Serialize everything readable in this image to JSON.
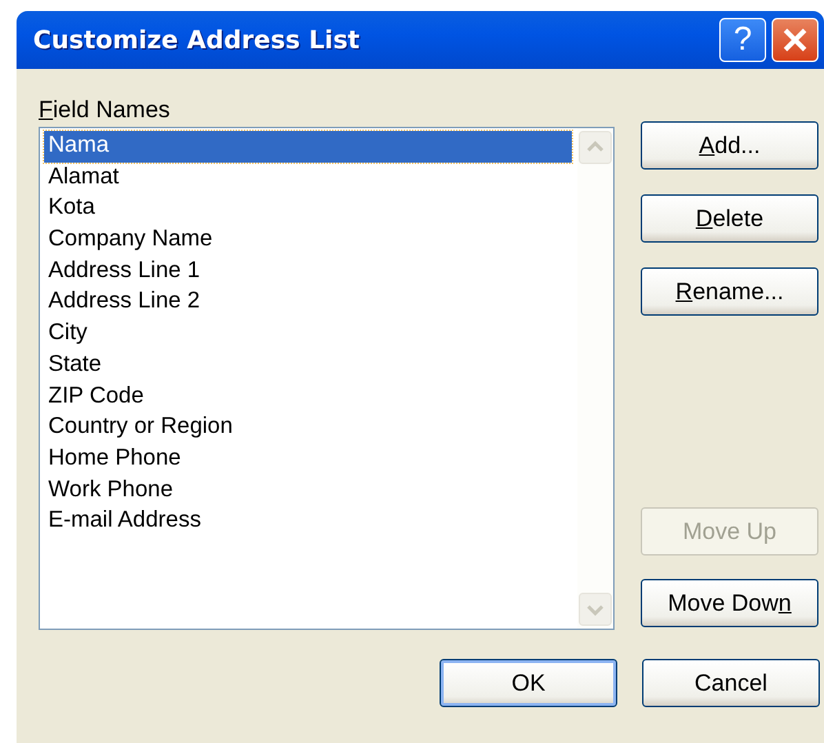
{
  "window": {
    "title": "Customize Address List",
    "help_button": "?"
  },
  "field_names": {
    "label": {
      "key": "F",
      "after": "ield Names"
    },
    "items": [
      {
        "text": "Nama",
        "selected": true
      },
      {
        "text": "Alamat",
        "selected": false
      },
      {
        "text": "Kota",
        "selected": false
      },
      {
        "text": "Company Name",
        "selected": false
      },
      {
        "text": "Address Line 1",
        "selected": false
      },
      {
        "text": "Address Line 2",
        "selected": false
      },
      {
        "text": "City",
        "selected": false
      },
      {
        "text": "State",
        "selected": false
      },
      {
        "text": "ZIP Code",
        "selected": false
      },
      {
        "text": "Country or Region",
        "selected": false
      },
      {
        "text": "Home Phone",
        "selected": false
      },
      {
        "text": "Work Phone",
        "selected": false
      },
      {
        "text": "E-mail Address",
        "selected": false
      }
    ]
  },
  "edit_buttons": [
    {
      "key": "A",
      "after": "dd...",
      "disabled": false
    },
    {
      "key": "D",
      "after": "elete",
      "disabled": false
    },
    {
      "key": "R",
      "after": "ename...",
      "disabled": false
    }
  ],
  "move_buttons": [
    {
      "before": "Move Up",
      "disabled": true
    },
    {
      "before": "Move Dow",
      "key": "n",
      "disabled": false
    }
  ],
  "footer_buttons": [
    {
      "label": "OK",
      "default": true
    },
    {
      "label": "Cancel",
      "default": false
    }
  ]
}
